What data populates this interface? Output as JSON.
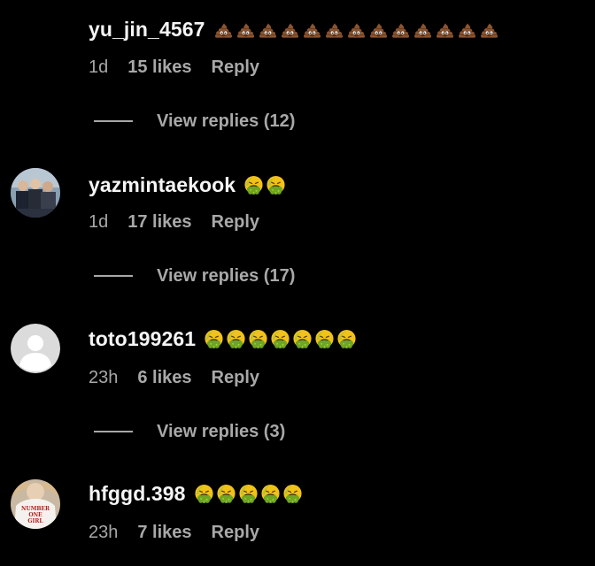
{
  "comments": [
    {
      "username": "yu_jin_4567",
      "emoji_icons": [
        "poop-icon",
        "poop-icon",
        "poop-icon",
        "poop-icon",
        "poop-icon",
        "poop-icon",
        "poop-icon",
        "poop-icon",
        "poop-icon",
        "poop-icon",
        "poop-icon",
        "poop-icon",
        "poop-icon"
      ],
      "time": "1d",
      "likes": "15 likes",
      "reply_label": "Reply",
      "view_replies": "View replies (12)"
    },
    {
      "username": "yazmintaekook",
      "avatar_icon": "profile-photo-group",
      "emoji_icons": [
        "vomiting-face-icon",
        "vomiting-face-icon"
      ],
      "time": "1d",
      "likes": "17 likes",
      "reply_label": "Reply",
      "view_replies": "View replies (17)"
    },
    {
      "username": "toto199261",
      "avatar_icon": "default-profile-icon",
      "emoji_icons": [
        "vomiting-face-icon",
        "vomiting-face-icon",
        "vomiting-face-icon",
        "vomiting-face-icon",
        "vomiting-face-icon",
        "vomiting-face-icon",
        "vomiting-face-icon"
      ],
      "time": "23h",
      "likes": "6 likes",
      "reply_label": "Reply",
      "view_replies": "View replies (3)"
    },
    {
      "username": "hfggd.398",
      "avatar_icon": "profile-photo-shirt",
      "avatar_text": "NUMBER ONE GIRL",
      "emoji_icons": [
        "vomiting-face-icon",
        "vomiting-face-icon",
        "vomiting-face-icon",
        "vomiting-face-icon",
        "vomiting-face-icon"
      ],
      "time": "23h",
      "likes": "7 likes",
      "reply_label": "Reply"
    }
  ],
  "colors": {
    "background": "#000000",
    "primary_text": "#f5f5f5",
    "secondary_text": "#a8a8a8"
  }
}
